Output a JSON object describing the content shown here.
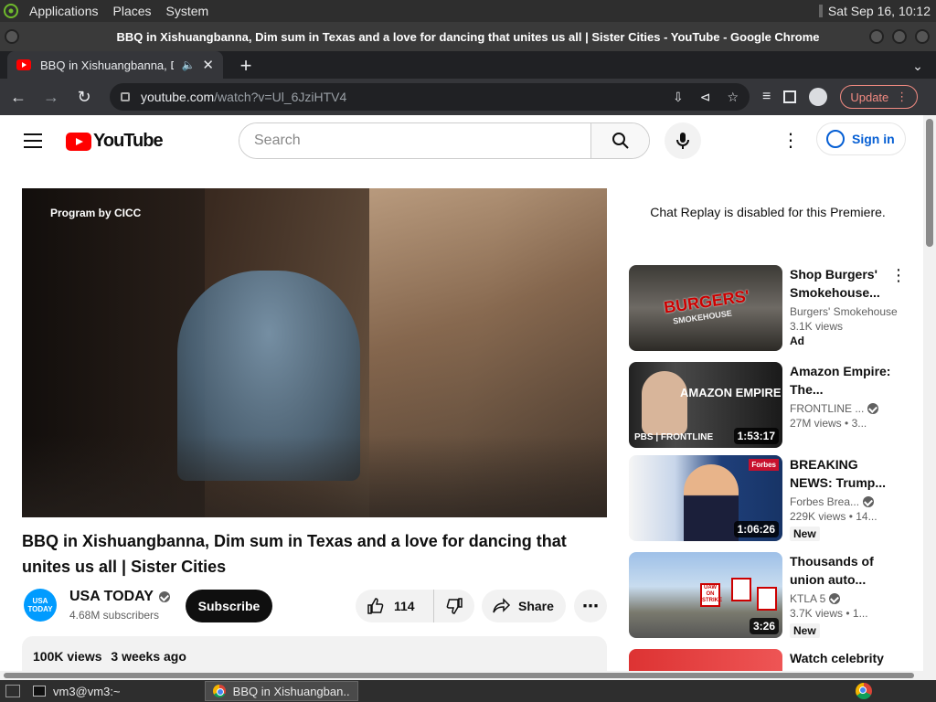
{
  "desktop": {
    "menus": [
      "Applications",
      "Places",
      "System"
    ],
    "clock": "Sat Sep 16, 10:12"
  },
  "window": {
    "title": "BBQ in Xishuangbanna, Dim sum in Texas and a love for dancing that unites us all | Sister Cities - YouTube - Google Chrome"
  },
  "browser": {
    "tab_title": "BBQ in Xishuangbanna, Dim sum",
    "url_host": "youtube.com",
    "url_path": "/watch?v=Ul_6JziHTV4",
    "update_label": "Update"
  },
  "youtube": {
    "logo_text": "YouTube",
    "search_placeholder": "Search",
    "sign_in": "Sign in",
    "video": {
      "caption": "Program by CICC",
      "title": "BBQ in Xishuangbanna, Dim sum in Texas and a love for dancing that unites us all | Sister Cities",
      "channel": "USA TODAY",
      "channel_avatar": "USA TODAY",
      "subscribers": "4.68M subscribers",
      "subscribe": "Subscribe",
      "likes": "114",
      "share": "Share",
      "views": "100K views",
      "age": "3 weeks ago"
    },
    "chat_replay": "Chat Replay is disabled for this Premiere.",
    "recommendations": [
      {
        "title": "Shop Burgers' Smokehouse...",
        "channel": "Burgers' Smokehouse",
        "views": "3.1K views",
        "badge": "Ad",
        "thumb_text": "BURGERS'",
        "thumb_sub": "SMOKEHOUSE"
      },
      {
        "title": "Amazon Empire: The...",
        "channel": "FRONTLINE ...",
        "views": "27M views",
        "age": "3...",
        "duration": "1:53:17",
        "thumb_text": "AMAZON EMPIRE",
        "thumb_sub": "PBS | FRONTLINE"
      },
      {
        "title": "BREAKING NEWS: Trump...",
        "channel": "Forbes Brea...",
        "views": "229K views",
        "age": "14...",
        "duration": "1:06:26",
        "badge": "New",
        "thumb_text": "Forbes"
      },
      {
        "title": "Thousands of union auto...",
        "channel": "KTLA 5",
        "views": "3.7K views",
        "age": "1...",
        "duration": "3:26",
        "badge": "New",
        "thumb_text": "UAW ON STRIKE"
      },
      {
        "title": "Watch celebrity"
      }
    ]
  },
  "taskbar": {
    "terminal": "vm3@vm3:~",
    "chrome": "BBQ in Xishuangban..."
  }
}
